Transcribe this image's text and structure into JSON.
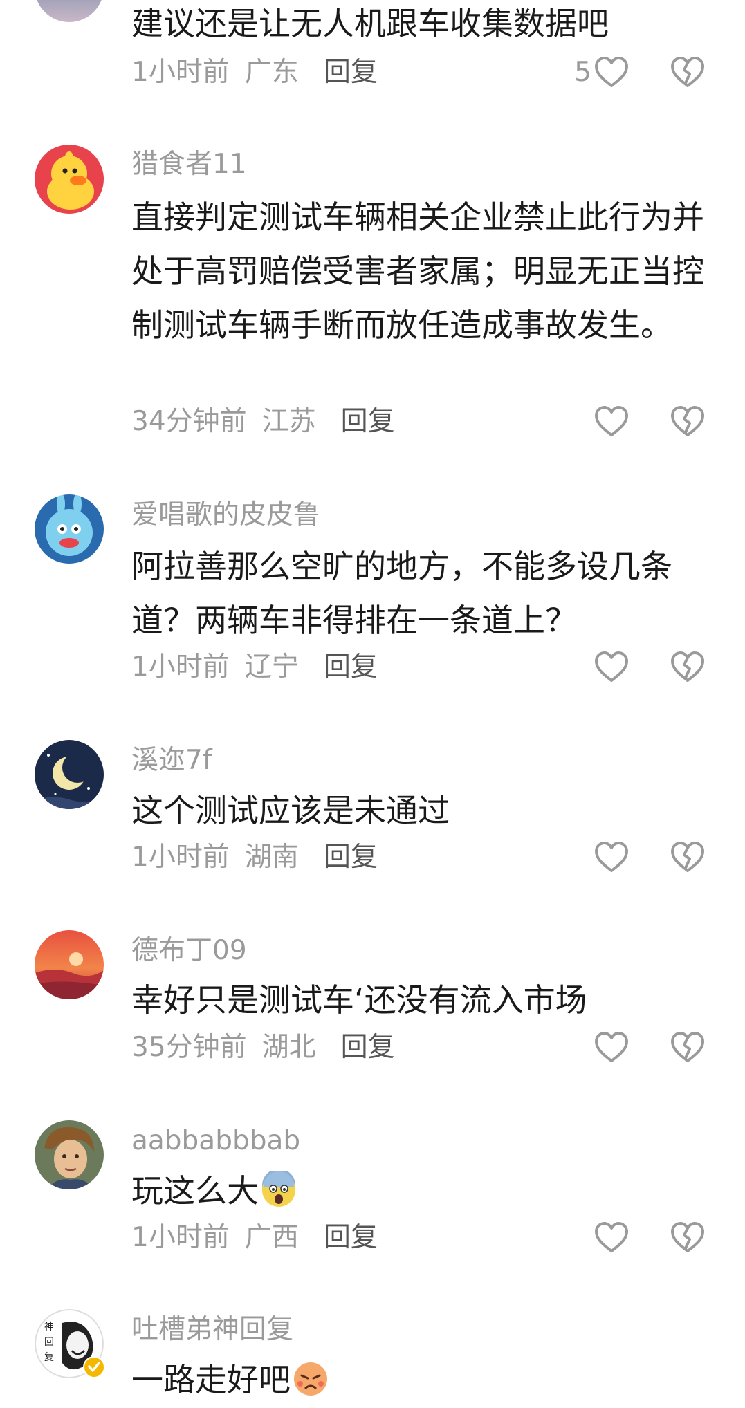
{
  "comments": [
    {
      "username": "",
      "text": "建议还是让无人机跟车收集数据吧",
      "time": "1小时前",
      "location": "广东",
      "reply_label": "回复",
      "likes": "5"
    },
    {
      "username": "猎食者11",
      "text": "直接判定测试车辆相关企业禁止此行为并处于高罚赔偿受害者家属；明显无正当控制测试车辆手断而放任造成事故发生。",
      "time": "34分钟前",
      "location": "江苏",
      "reply_label": "回复",
      "likes": ""
    },
    {
      "username": "爱唱歌的皮皮鲁",
      "text": "阿拉善那么空旷的地方，不能多设几条道？两辆车非得排在一条道上？",
      "time": "1小时前",
      "location": "辽宁",
      "reply_label": "回复",
      "likes": ""
    },
    {
      "username": "溪迩7f",
      "text": "这个测试应该是未通过",
      "time": "1小时前",
      "location": "湖南",
      "reply_label": "回复",
      "likes": ""
    },
    {
      "username": "德布丁09",
      "text": "幸好只是测试车‘还没有流入市场",
      "time": "35分钟前",
      "location": "湖北",
      "reply_label": "回复",
      "likes": ""
    },
    {
      "username": "aabbabbbab",
      "text": "玩这么大",
      "emoji": "fearful-face-emoji",
      "time": "1小时前",
      "location": "广西",
      "reply_label": "回复",
      "likes": ""
    },
    {
      "username": "吐槽弟神回复",
      "text": "一路走好吧",
      "emoji": "pouting-face-emoji",
      "time": "",
      "location": "",
      "reply_label": "",
      "likes": ""
    }
  ],
  "icons": {
    "like": "heart-outline-icon",
    "dislike": "broken-heart-outline-icon",
    "verified": "verified-badge-icon"
  },
  "colors": {
    "username": "#9a9a9a",
    "text": "#1a1a1a",
    "reply": "#555555",
    "icon": "#9a9a9a",
    "verified_badge": "#f5b800"
  }
}
